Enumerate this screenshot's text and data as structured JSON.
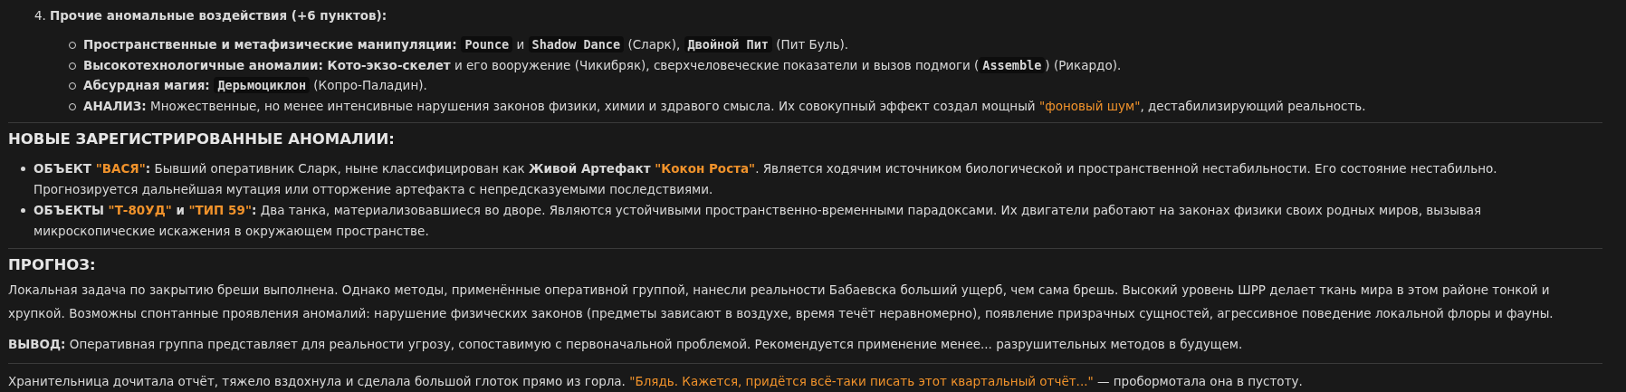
{
  "blocks": [
    {
      "kind": "numbered",
      "number": "4.",
      "segments": [
        {
          "kind": "bold",
          "text": "Прочие аномальные воздействия (+6 пунктов):"
        }
      ],
      "children": [
        {
          "segments": [
            {
              "kind": "bold",
              "text": "Пространственные и метафизические манипуляции: "
            },
            {
              "kind": "code",
              "text": "Pounce"
            },
            {
              "kind": "plain",
              "text": " и "
            },
            {
              "kind": "code",
              "text": "Shadow Dance"
            },
            {
              "kind": "plain",
              "text": " (Сларк), "
            },
            {
              "kind": "code",
              "text": "Двойной Пит"
            },
            {
              "kind": "plain",
              "text": " (Пит Буль)."
            }
          ]
        },
        {
          "segments": [
            {
              "kind": "bold",
              "text": "Высокотехнологичные аномалии: Кото-экзо-скелет"
            },
            {
              "kind": "plain",
              "text": " и его вооружение (Чикибряк), сверхчеловеческие показатели и вызов подмоги ("
            },
            {
              "kind": "code",
              "text": "Assemble"
            },
            {
              "kind": "plain",
              "text": ") (Рикардо)."
            }
          ]
        },
        {
          "segments": [
            {
              "kind": "bold",
              "text": "Абсурдная магия: "
            },
            {
              "kind": "code",
              "text": "Дерьмоциклон"
            },
            {
              "kind": "plain",
              "text": " (Копро-Паладин)."
            }
          ]
        },
        {
          "segments": [
            {
              "kind": "bold",
              "text": "АНАЛИЗ:"
            },
            {
              "kind": "plain",
              "text": " Множественные, но менее интенсивные нарушения законов физики, химии и здравого смысла. Их совокупный эффект создал мощный "
            },
            {
              "kind": "accent",
              "text": "\"фоновый шум\""
            },
            {
              "kind": "plain",
              "text": ", дестабилизирующий реальность."
            }
          ]
        }
      ]
    },
    {
      "kind": "rule"
    },
    {
      "kind": "heading",
      "text": "НОВЫЕ ЗАРЕГИСТРИРОВАННЫЕ АНОМАЛИИ:"
    },
    {
      "kind": "bullets",
      "items": [
        {
          "segments": [
            {
              "kind": "bold",
              "text": "ОБЪЕКТ "
            },
            {
              "kind": "accent_bold",
              "text": "\"ВАСЯ\""
            },
            {
              "kind": "bold",
              "text": ":"
            },
            {
              "kind": "plain",
              "text": " Бывший оперативник Сларк, ныне классифицирован как "
            },
            {
              "kind": "bold",
              "text": "Живой Артефакт "
            },
            {
              "kind": "accent_bold",
              "text": "\"Кокон Роста\""
            },
            {
              "kind": "plain",
              "text": ". Является ходячим источником биологической и пространственной нестабильности. Его состояние нестабильно. Прогнозируется дальнейшая мутация или отторжение артефакта с непредсказуемыми последствиями."
            }
          ]
        },
        {
          "segments": [
            {
              "kind": "bold",
              "text": "ОБЪЕКТЫ "
            },
            {
              "kind": "accent_bold",
              "text": "\"Т-80УД\""
            },
            {
              "kind": "bold",
              "text": " и "
            },
            {
              "kind": "accent_bold",
              "text": "\"ТИП 59\""
            },
            {
              "kind": "bold",
              "text": ":"
            },
            {
              "kind": "plain",
              "text": " Два танка, материализовавшиеся во дворе. Являются устойчивыми пространственно-временными парадоксами. Их двигатели работают на законах физики своих родных миров, вызывая микроскопические искажения в окружающем пространстве."
            }
          ]
        }
      ]
    },
    {
      "kind": "rule"
    },
    {
      "kind": "heading",
      "text": "ПРОГНОЗ:"
    },
    {
      "kind": "paragraph",
      "segments": [
        {
          "kind": "plain",
          "text": "Локальная задача по закрытию бреши выполнена. Однако методы, применённые оперативной группой, нанесли реальности Бабаевска больший ущерб, чем сама брешь. Высокий уровень ШРР делает ткань мира в этом районе тонкой и хрупкой. Возможны спонтанные проявления аномалий: нарушение физических законов (предметы зависают в воздухе, время течёт неравномерно), появление призрачных сущностей, агрессивное поведение локальной флоры и фауны."
        }
      ]
    },
    {
      "kind": "paragraph",
      "segments": [
        {
          "kind": "bold",
          "text": "ВЫВОД:"
        },
        {
          "kind": "plain",
          "text": " Оперативная группа представляет для реальности угрозу, сопоставимую с первоначальной проблемой. Рекомендуется применение менее... разрушительных методов в будущем."
        }
      ]
    },
    {
      "kind": "rule"
    },
    {
      "kind": "paragraph",
      "segments": [
        {
          "kind": "plain",
          "text": "Хранительница дочитала отчёт, тяжело вздохнула и сделала большой глоток прямо из горла. "
        },
        {
          "kind": "accent",
          "text": "\"Блядь. Кажется, придётся всё-таки писать этот квартальный отчёт...\""
        },
        {
          "kind": "plain",
          "text": " — пробормотала она в пустоту."
        }
      ]
    }
  ]
}
